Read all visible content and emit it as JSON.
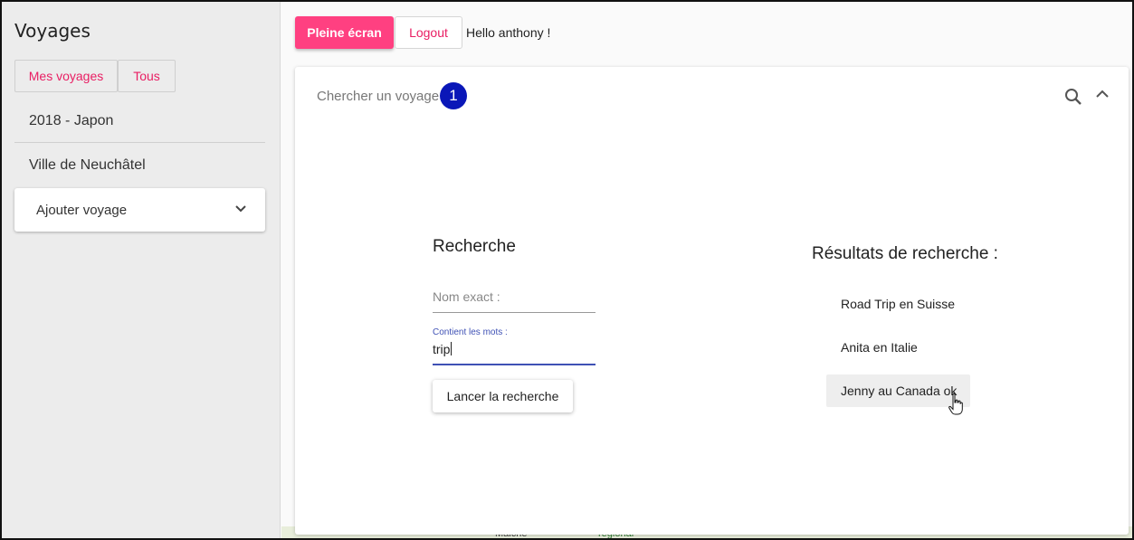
{
  "sidebar": {
    "title": "Voyages",
    "filters": {
      "mine_label": "Mes voyages",
      "all_label": "Tous"
    },
    "trips": [
      "2018 - Japon",
      "Ville de Neuchâtel"
    ],
    "add_trip_label": "Ajouter voyage",
    "add_trip_icon": "chevron-down-icon"
  },
  "toolbar": {
    "fullscreen_label": "Pleine écran",
    "logout_label": "Logout",
    "greeting": "Hello anthony !"
  },
  "search_panel": {
    "title": "Chercher un voyage",
    "step_badge": "1",
    "search_icon": "search-icon",
    "collapse_icon": "chevron-up-icon",
    "form": {
      "heading": "Recherche",
      "exact_name_placeholder": "Nom exact :",
      "contains_words_label": "Contient les mots :",
      "contains_words_value": "trip",
      "submit_label": "Lancer la recherche"
    },
    "results": {
      "heading": "Résultats de recherche :",
      "items": [
        "Road Trip en Suisse",
        "Anita en Italie",
        "Jenny au Canada ok"
      ],
      "hovered_index": 2
    }
  },
  "map_background": {
    "labels": [
      "Maiche",
      "regional"
    ]
  },
  "colors": {
    "accent_pink": "#ff4081",
    "badge_blue": "#0a17b8",
    "input_focus": "#3f51b5"
  }
}
